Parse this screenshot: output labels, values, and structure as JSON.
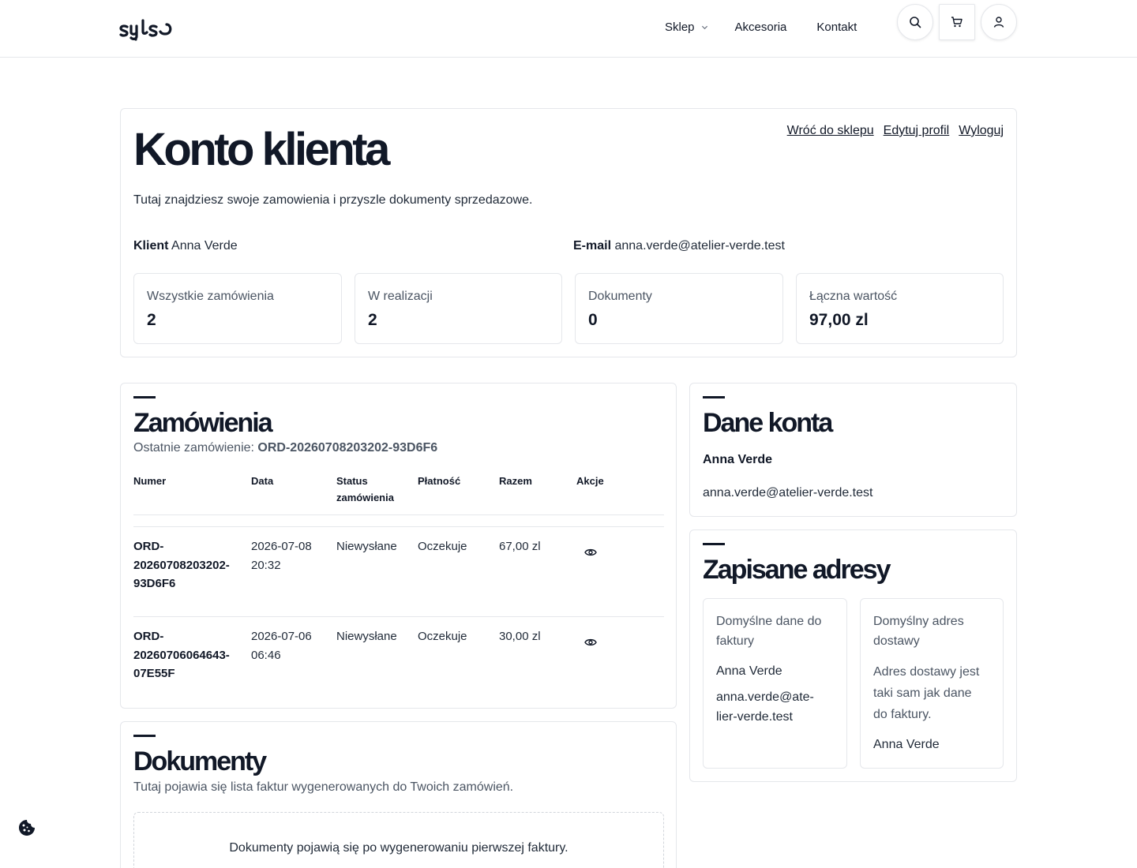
{
  "brand": {
    "logo_text": "syls"
  },
  "nav": {
    "shop": "Sklep",
    "accessories": "Akcesoria",
    "contact": "Kontakt"
  },
  "header_icons": [
    "search-icon",
    "cart-icon",
    "user-icon"
  ],
  "hero": {
    "title": "Konto klienta",
    "links": {
      "back": "Wróć do sklepu",
      "edit": "Edytuj profil",
      "logout": "Wyloguj"
    },
    "description": "Tutaj znajdziesz swoje zamowienia i przyszle dokumenty sprzedazowe.",
    "client_label": "Klient",
    "client_value": "Anna Verde",
    "email_label": "E-mail",
    "email_value": "anna.verde@atelier-verde.test",
    "stats": [
      {
        "label": "Wszystkie zamówienia",
        "value": "2"
      },
      {
        "label": "W realizacji",
        "value": "2"
      },
      {
        "label": "Dokumenty",
        "value": "0"
      },
      {
        "label": "Łączna wartość",
        "value": "97,00 zl"
      }
    ]
  },
  "orders": {
    "title": "Zamówienia",
    "last_label": "Ostatnie zamówienie:",
    "last_value": "ORD-20260708203202-93D6F6",
    "columns": {
      "number": "Numer",
      "date": "Data",
      "status_1": "Status",
      "status_2": "zamówienia",
      "payment": "Płatność",
      "total": "Razem",
      "actions": "Akcje"
    },
    "rows": [
      {
        "num_1": "ORD-",
        "num_2": "20260708203202-",
        "num_3": "93D6F6",
        "date_1": "2026-07-08",
        "date_2": "20:32",
        "status": "Niewysłane",
        "payment": "Oczekuje",
        "total": "67,00 zl"
      },
      {
        "num_1": "ORD-",
        "num_2": "20260706064643-",
        "num_3": "07E55F",
        "date_1": "2026-07-06",
        "date_2": "06:46",
        "status": "Niewysłane",
        "payment": "Oczekuje",
        "total": "30,00 zl"
      }
    ]
  },
  "documents": {
    "title": "Dokumenty",
    "subtitle": "Tutaj pojawia się lista faktur wygenerowanych do Twoich zamówień.",
    "empty": "Dokumenty pojawią się po wygenerowaniu pierwszej faktury."
  },
  "account": {
    "title": "Dane konta",
    "name": "Anna Verde",
    "email": "anna.verde@atelier-verde.test"
  },
  "addresses": {
    "title": "Zapisane adresy",
    "billing": {
      "label_1": "Domyślne dane do",
      "label_2": "faktury",
      "name": "Anna Verde",
      "email_1": "anna.verde@ate-",
      "email_2": "lier-verde.test"
    },
    "shipping": {
      "label_1": "Domyślny adres",
      "label_2": "dostawy",
      "note_1": "Adres dostawy jest",
      "note_2": "taki sam jak dane",
      "note_3": "do faktury.",
      "name": "Anna Verde"
    }
  },
  "cookie_icon": "cookie-icon"
}
